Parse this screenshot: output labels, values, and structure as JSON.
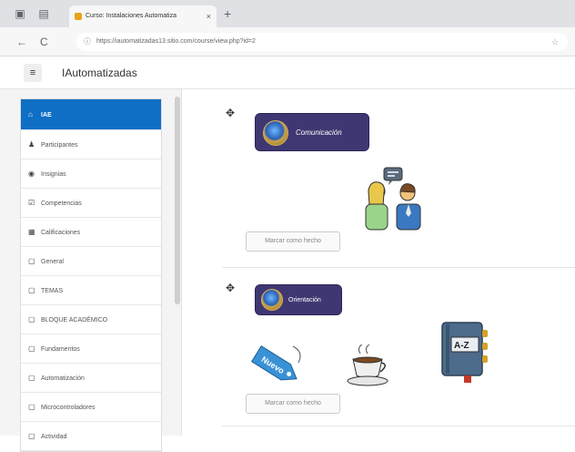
{
  "browser": {
    "tab_title": "Curso: Instalaciones Automatiza",
    "tab_close": "×",
    "new_tab": "+",
    "url": "https://iautomatizadas13.sitio.com/course/view.php?id=2",
    "back": "←",
    "reload": "C",
    "lock": "ⓘ",
    "star": "☆"
  },
  "header": {
    "menu_icon": "≡",
    "site_title": "IAutomatizadas"
  },
  "drawer": {
    "items": [
      {
        "label": "IAE",
        "icon": "graduation-cap-icon",
        "glyph": "⌂",
        "active": true
      },
      {
        "label": "Participantes",
        "icon": "users-icon",
        "glyph": "♟"
      },
      {
        "label": "Insignias",
        "icon": "shield-icon",
        "glyph": "◉"
      },
      {
        "label": "Competencias",
        "icon": "check-square-icon",
        "glyph": "☑"
      },
      {
        "label": "Calificaciones",
        "icon": "table-icon",
        "glyph": "▦"
      },
      {
        "label": "General",
        "icon": "folder-icon",
        "glyph": "▢"
      },
      {
        "label": "TEMAS",
        "icon": "folder-icon",
        "glyph": "▢"
      },
      {
        "label": "BLOQUE ACADÉMICO",
        "icon": "folder-icon",
        "glyph": "▢"
      },
      {
        "label": "Fundamentos",
        "icon": "folder-icon",
        "glyph": "▢"
      },
      {
        "label": "Automatización",
        "icon": "folder-icon",
        "glyph": "▢"
      },
      {
        "label": "Microcontroladores",
        "icon": "folder-icon",
        "glyph": "▢"
      },
      {
        "label": "Actividad",
        "icon": "folder-icon",
        "glyph": "▢"
      }
    ]
  },
  "sections": [
    {
      "badge": "Comunicación",
      "complete_label": "Marcar como hecho",
      "illustrations": [
        "people-talking-icon"
      ]
    },
    {
      "badge": "Orientación",
      "complete_label": "Marcar como hecho",
      "illustrations": [
        "new-tag-icon",
        "coffee-cup-icon",
        "notebook-icon"
      ],
      "tag_text": "Nuevo",
      "notebook_text": "A-Z"
    }
  ],
  "colors": {
    "accent": "#0f6fc5",
    "badge_bg": "#3f3772",
    "badge_glow": "#f0d84a"
  }
}
